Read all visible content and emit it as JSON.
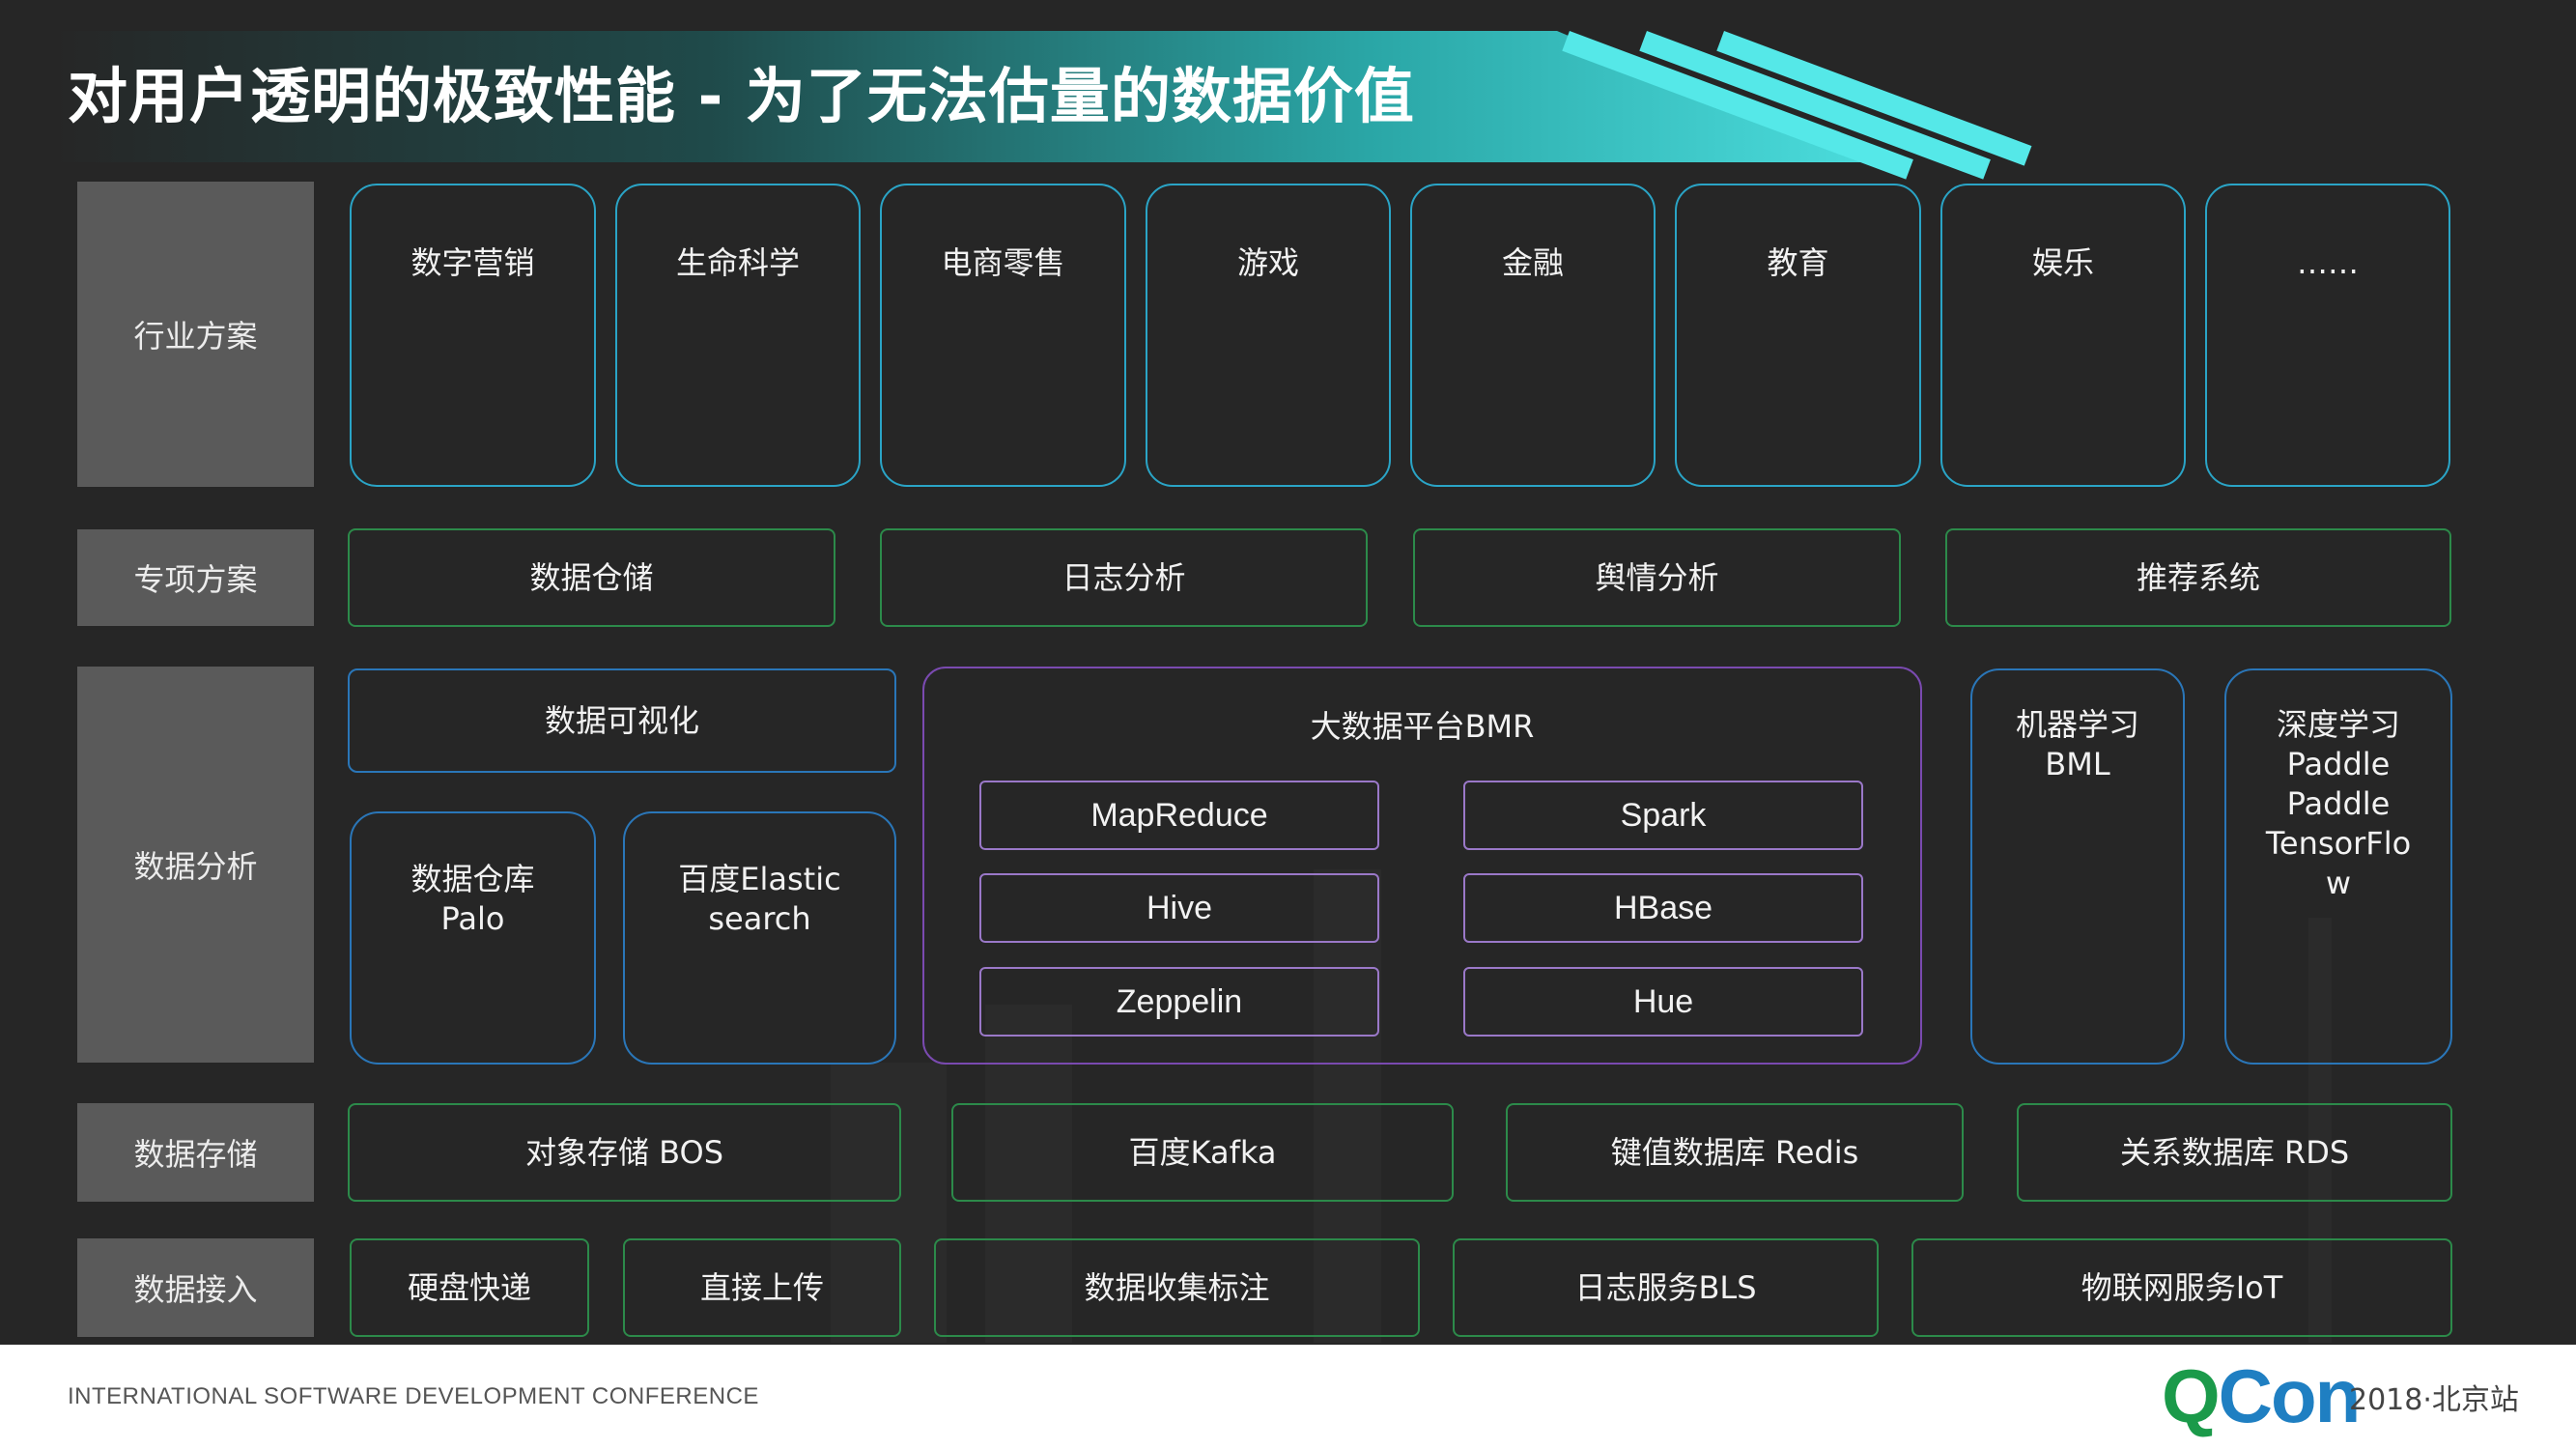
{
  "title": "对用户透明的极致性能 - 为了无法估量的数据价值",
  "categories": {
    "industry": "行业方案",
    "special": "专项方案",
    "analysis": "数据分析",
    "storage": "数据存储",
    "access": "数据接入"
  },
  "industry_solutions": [
    "数字营销",
    "生命科学",
    "电商零售",
    "游戏",
    "金融",
    "教育",
    "娱乐",
    "……"
  ],
  "special_solutions": [
    "数据仓储",
    "日志分析",
    "舆情分析",
    "推荐系统"
  ],
  "analysis": {
    "visualization": "数据可视化",
    "warehouse": "数据仓库\nPalo",
    "elastic": "百度Elastic\nsearch",
    "bmr": {
      "title": "大数据平台BMR",
      "items": [
        "MapReduce",
        "Spark",
        "Hive",
        "HBase",
        "Zeppelin",
        "Hue"
      ]
    },
    "ml": "机器学习\nBML",
    "dl": "深度学习\nPaddle\nPaddle\nTensorFlo\nw"
  },
  "storage": [
    "对象存储 BOS",
    "百度Kafka",
    "键值数据库 Redis",
    "关系数据库 RDS"
  ],
  "access": [
    "硬盘快递",
    "直接上传",
    "数据收集标注",
    "日志服务BLS",
    "物联网服务IoT"
  ],
  "footer": {
    "conference": "INTERNATIONAL SOFTWARE DEVELOPMENT CONFERENCE",
    "logo_q": "Q",
    "logo_rest": "Con",
    "year_city": "2018·北京站"
  },
  "colors": {
    "background": "#262626",
    "banner_accent": "#4fe3e3",
    "category_fill": "#5a5a5a",
    "industry_border": "#2aa4c6",
    "green_border": "#2c8a4a",
    "blue_border": "#2a76b8",
    "purple_border": "#7a4ab0",
    "logo_blue": "#1f7fc2",
    "logo_green": "#1b9a4a"
  }
}
